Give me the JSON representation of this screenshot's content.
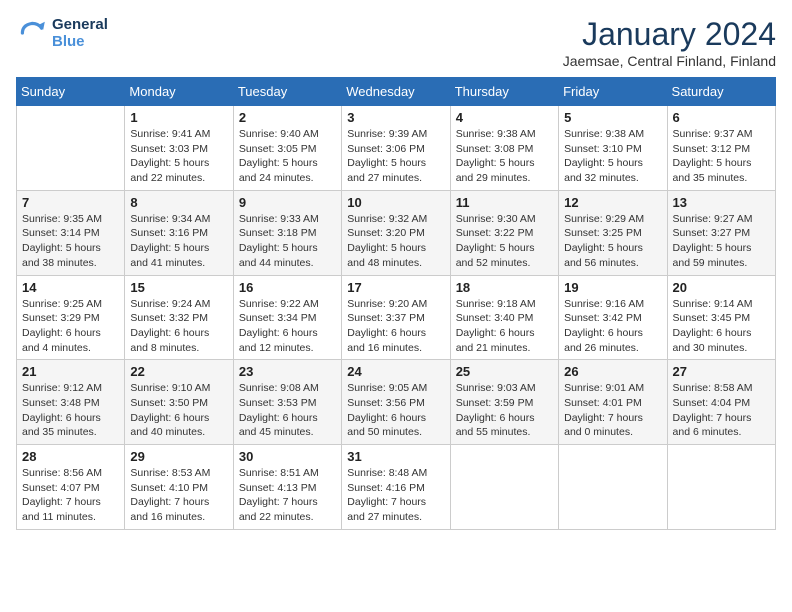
{
  "logo": {
    "line1": "General",
    "line2": "Blue"
  },
  "title": "January 2024",
  "location": "Jaemsae, Central Finland, Finland",
  "weekdays": [
    "Sunday",
    "Monday",
    "Tuesday",
    "Wednesday",
    "Thursday",
    "Friday",
    "Saturday"
  ],
  "weeks": [
    [
      {
        "day": "",
        "info": ""
      },
      {
        "day": "1",
        "info": "Sunrise: 9:41 AM\nSunset: 3:03 PM\nDaylight: 5 hours\nand 22 minutes."
      },
      {
        "day": "2",
        "info": "Sunrise: 9:40 AM\nSunset: 3:05 PM\nDaylight: 5 hours\nand 24 minutes."
      },
      {
        "day": "3",
        "info": "Sunrise: 9:39 AM\nSunset: 3:06 PM\nDaylight: 5 hours\nand 27 minutes."
      },
      {
        "day": "4",
        "info": "Sunrise: 9:38 AM\nSunset: 3:08 PM\nDaylight: 5 hours\nand 29 minutes."
      },
      {
        "day": "5",
        "info": "Sunrise: 9:38 AM\nSunset: 3:10 PM\nDaylight: 5 hours\nand 32 minutes."
      },
      {
        "day": "6",
        "info": "Sunrise: 9:37 AM\nSunset: 3:12 PM\nDaylight: 5 hours\nand 35 minutes."
      }
    ],
    [
      {
        "day": "7",
        "info": "Sunrise: 9:35 AM\nSunset: 3:14 PM\nDaylight: 5 hours\nand 38 minutes."
      },
      {
        "day": "8",
        "info": "Sunrise: 9:34 AM\nSunset: 3:16 PM\nDaylight: 5 hours\nand 41 minutes."
      },
      {
        "day": "9",
        "info": "Sunrise: 9:33 AM\nSunset: 3:18 PM\nDaylight: 5 hours\nand 44 minutes."
      },
      {
        "day": "10",
        "info": "Sunrise: 9:32 AM\nSunset: 3:20 PM\nDaylight: 5 hours\nand 48 minutes."
      },
      {
        "day": "11",
        "info": "Sunrise: 9:30 AM\nSunset: 3:22 PM\nDaylight: 5 hours\nand 52 minutes."
      },
      {
        "day": "12",
        "info": "Sunrise: 9:29 AM\nSunset: 3:25 PM\nDaylight: 5 hours\nand 56 minutes."
      },
      {
        "day": "13",
        "info": "Sunrise: 9:27 AM\nSunset: 3:27 PM\nDaylight: 5 hours\nand 59 minutes."
      }
    ],
    [
      {
        "day": "14",
        "info": "Sunrise: 9:25 AM\nSunset: 3:29 PM\nDaylight: 6 hours\nand 4 minutes."
      },
      {
        "day": "15",
        "info": "Sunrise: 9:24 AM\nSunset: 3:32 PM\nDaylight: 6 hours\nand 8 minutes."
      },
      {
        "day": "16",
        "info": "Sunrise: 9:22 AM\nSunset: 3:34 PM\nDaylight: 6 hours\nand 12 minutes."
      },
      {
        "day": "17",
        "info": "Sunrise: 9:20 AM\nSunset: 3:37 PM\nDaylight: 6 hours\nand 16 minutes."
      },
      {
        "day": "18",
        "info": "Sunrise: 9:18 AM\nSunset: 3:40 PM\nDaylight: 6 hours\nand 21 minutes."
      },
      {
        "day": "19",
        "info": "Sunrise: 9:16 AM\nSunset: 3:42 PM\nDaylight: 6 hours\nand 26 minutes."
      },
      {
        "day": "20",
        "info": "Sunrise: 9:14 AM\nSunset: 3:45 PM\nDaylight: 6 hours\nand 30 minutes."
      }
    ],
    [
      {
        "day": "21",
        "info": "Sunrise: 9:12 AM\nSunset: 3:48 PM\nDaylight: 6 hours\nand 35 minutes."
      },
      {
        "day": "22",
        "info": "Sunrise: 9:10 AM\nSunset: 3:50 PM\nDaylight: 6 hours\nand 40 minutes."
      },
      {
        "day": "23",
        "info": "Sunrise: 9:08 AM\nSunset: 3:53 PM\nDaylight: 6 hours\nand 45 minutes."
      },
      {
        "day": "24",
        "info": "Sunrise: 9:05 AM\nSunset: 3:56 PM\nDaylight: 6 hours\nand 50 minutes."
      },
      {
        "day": "25",
        "info": "Sunrise: 9:03 AM\nSunset: 3:59 PM\nDaylight: 6 hours\nand 55 minutes."
      },
      {
        "day": "26",
        "info": "Sunrise: 9:01 AM\nSunset: 4:01 PM\nDaylight: 7 hours\nand 0 minutes."
      },
      {
        "day": "27",
        "info": "Sunrise: 8:58 AM\nSunset: 4:04 PM\nDaylight: 7 hours\nand 6 minutes."
      }
    ],
    [
      {
        "day": "28",
        "info": "Sunrise: 8:56 AM\nSunset: 4:07 PM\nDaylight: 7 hours\nand 11 minutes."
      },
      {
        "day": "29",
        "info": "Sunrise: 8:53 AM\nSunset: 4:10 PM\nDaylight: 7 hours\nand 16 minutes."
      },
      {
        "day": "30",
        "info": "Sunrise: 8:51 AM\nSunset: 4:13 PM\nDaylight: 7 hours\nand 22 minutes."
      },
      {
        "day": "31",
        "info": "Sunrise: 8:48 AM\nSunset: 4:16 PM\nDaylight: 7 hours\nand 27 minutes."
      },
      {
        "day": "",
        "info": ""
      },
      {
        "day": "",
        "info": ""
      },
      {
        "day": "",
        "info": ""
      }
    ]
  ]
}
